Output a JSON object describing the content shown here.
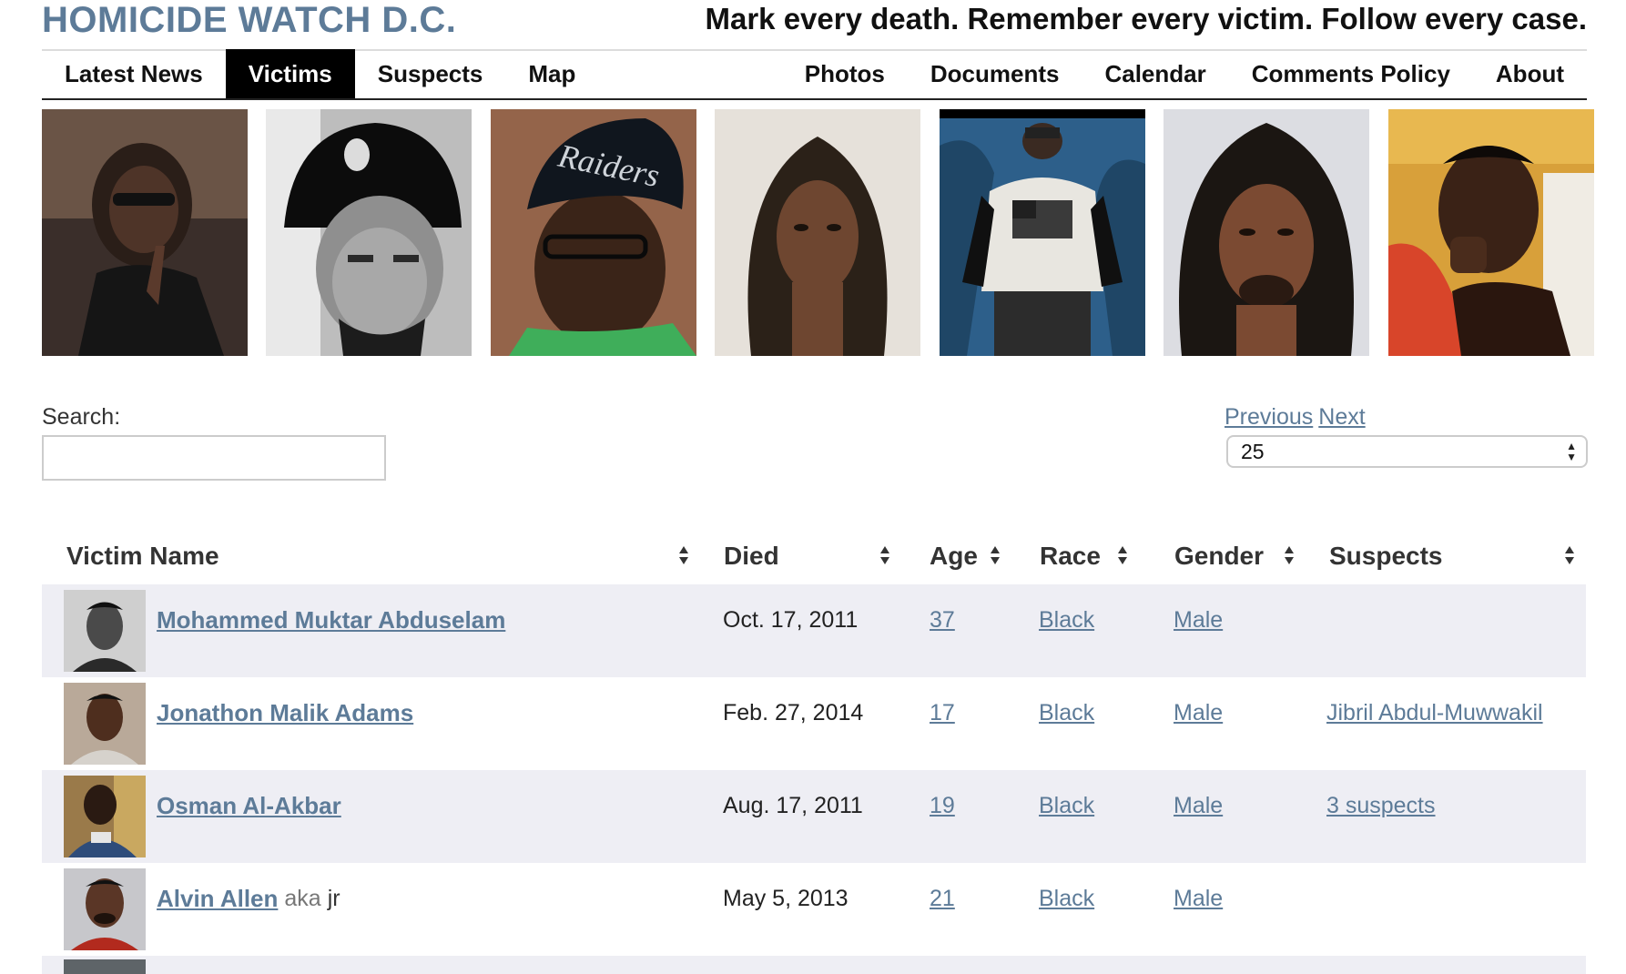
{
  "site": {
    "title": "HOMICIDE WATCH D.C.",
    "tagline": "Mark every death. Remember every victim. Follow every case."
  },
  "nav": {
    "left": [
      {
        "label": "Latest News",
        "active": false
      },
      {
        "label": "Victims",
        "active": true
      },
      {
        "label": "Suspects",
        "active": false
      },
      {
        "label": "Map",
        "active": false
      }
    ],
    "right": [
      {
        "label": "Photos"
      },
      {
        "label": "Documents"
      },
      {
        "label": "Calendar"
      },
      {
        "label": "Comments Policy"
      },
      {
        "label": "About"
      }
    ]
  },
  "photo_strip": [
    {
      "icon": "victim-photo"
    },
    {
      "icon": "victim-photo"
    },
    {
      "icon": "victim-photo"
    },
    {
      "icon": "victim-photo"
    },
    {
      "icon": "victim-photo"
    },
    {
      "icon": "victim-photo"
    },
    {
      "icon": "victim-photo"
    }
  ],
  "controls": {
    "search_label": "Search:",
    "search_value": "",
    "pager": {
      "previous": "Previous",
      "next": "Next"
    },
    "per_page": "25"
  },
  "table": {
    "columns": [
      "Victim Name",
      "Died",
      "Age",
      "Race",
      "Gender",
      "Suspects"
    ],
    "rows": [
      {
        "name": "Mohammed Muktar Abduselam",
        "aka_label": "",
        "aka": "",
        "died": "Oct. 17, 2011",
        "age": "37",
        "race": "Black",
        "gender": "Male",
        "suspects": ""
      },
      {
        "name": "Jonathon Malik Adams",
        "aka_label": "",
        "aka": "",
        "died": "Feb. 27, 2014",
        "age": "17",
        "race": "Black",
        "gender": "Male",
        "suspects": "Jibril Abdul-Muwwakil"
      },
      {
        "name": "Osman Al-Akbar",
        "aka_label": "",
        "aka": "",
        "died": "Aug. 17, 2011",
        "age": "19",
        "race": "Black",
        "gender": "Male",
        "suspects": "3 suspects"
      },
      {
        "name": "Alvin Allen",
        "aka_label": "aka",
        "aka": "jr",
        "died": "May 5, 2013",
        "age": "21",
        "race": "Black",
        "gender": "Male",
        "suspects": ""
      }
    ]
  }
}
